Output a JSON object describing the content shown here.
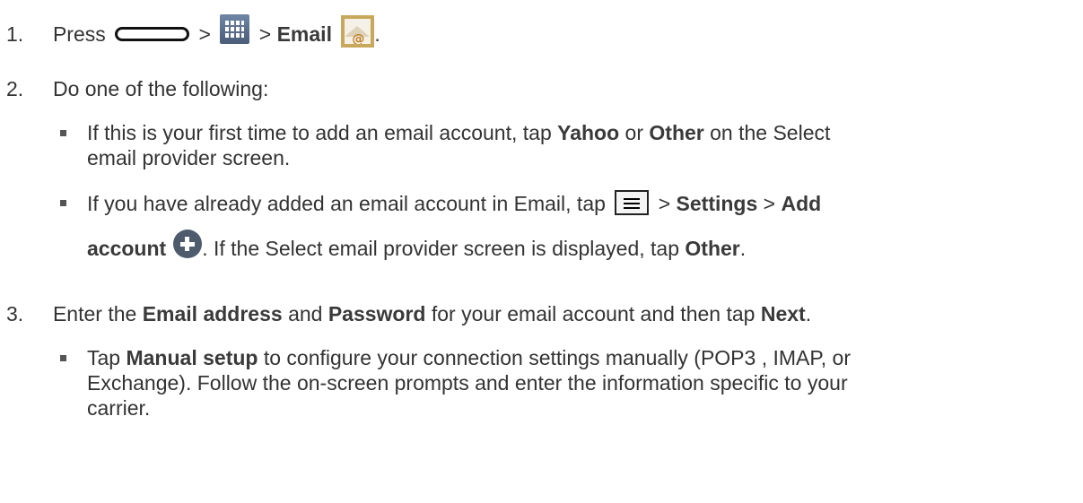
{
  "steps": [
    {
      "number": "1.",
      "press": "Press",
      "sep": ">",
      "email": "Email",
      "period": "."
    },
    {
      "number": "2.",
      "text": "Do one of the following:",
      "bullets": [
        {
          "line1_a": "If this is your first time to add an email account, tap",
          "yahoo": "Yahoo",
          "or": "or",
          "other": "Other",
          "line1_b": "on the Select",
          "line2": "email provider screen."
        },
        {
          "line1_a": "If you have already added an email account in Email, tap",
          "sep": ">",
          "settings": "Settings",
          "add": "Add",
          "account": "account",
          "line2_b": ". If the Select email provider screen is displayed, tap",
          "other": "Other",
          "period": "."
        }
      ]
    },
    {
      "number": "3.",
      "enter": "Enter the",
      "email_address": "Email address",
      "and": "and",
      "password": "Password",
      "rest": "for your email account and then tap",
      "next": "Next",
      "period": ".",
      "bullets": [
        {
          "tap": "Tap",
          "manual_setup": "Manual setup",
          "line1_b": "to configure your connection settings manually (POP3 , IMAP, or",
          "line2": "Exchange). Follow the on-screen prompts and enter the information specific to your",
          "line3": "carrier."
        }
      ]
    }
  ],
  "icons": {
    "home_key": "home-key-icon",
    "apps": "apps-icon",
    "email": "email-icon",
    "menu": "menu-icon",
    "add": "add-icon"
  }
}
